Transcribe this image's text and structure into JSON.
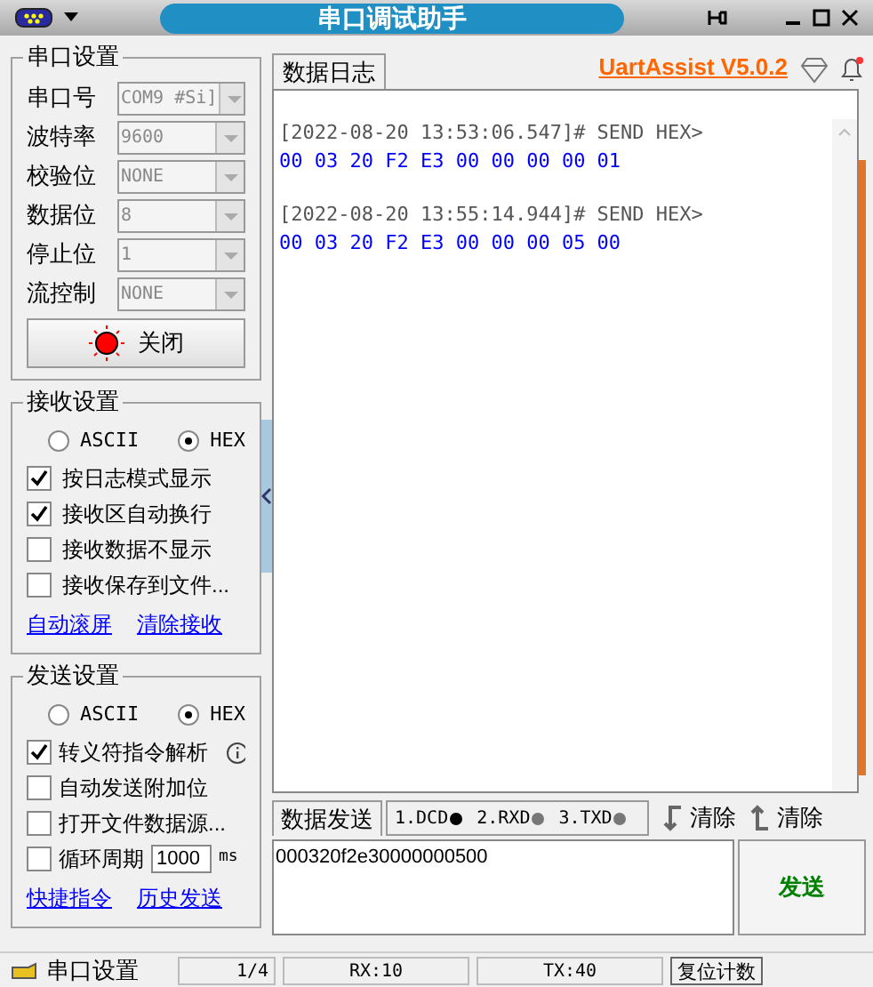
{
  "window": {
    "title": "串口调试助手"
  },
  "port_settings": {
    "title": "串口设置",
    "fields": [
      {
        "label": "串口号",
        "value": "COM9 #Si]"
      },
      {
        "label": "波特率",
        "value": "9600"
      },
      {
        "label": "校验位",
        "value": "NONE"
      },
      {
        "label": "数据位",
        "value": "8"
      },
      {
        "label": "停止位",
        "value": "1"
      },
      {
        "label": "流控制",
        "value": "NONE"
      }
    ],
    "toggle_button": {
      "label": "关闭",
      "on": true
    }
  },
  "receive_settings": {
    "title": "接收设置",
    "modes": [
      {
        "label": "ASCII",
        "selected": false
      },
      {
        "label": "HEX",
        "selected": true
      }
    ],
    "options": [
      {
        "label": "按日志模式显示",
        "checked": true
      },
      {
        "label": "接收区自动换行",
        "checked": true
      },
      {
        "label": "接收数据不显示",
        "checked": false
      },
      {
        "label": "接收保存到文件...",
        "checked": false
      }
    ],
    "links": [
      "自动滚屏",
      "清除接收"
    ]
  },
  "send_settings": {
    "title": "发送设置",
    "modes": [
      {
        "label": "ASCII",
        "selected": false
      },
      {
        "label": "HEX",
        "selected": true
      }
    ],
    "options": [
      {
        "label": "转义符指令解析",
        "checked": true,
        "kind": "info"
      },
      {
        "label": "自动发送附加位",
        "checked": false,
        "kind": "plain"
      },
      {
        "label": "打开文件数据源...",
        "checked": false,
        "kind": "plain"
      },
      {
        "label": "循环周期",
        "checked": false,
        "kind": "period",
        "value": "1000",
        "unit": "ms"
      }
    ],
    "links": [
      "快捷指令",
      "历史发送"
    ]
  },
  "log_tab": {
    "label": "数据日志",
    "selected": true
  },
  "app_link": "UartAssist V5.0.2",
  "log": [
    {
      "header": "[2022-08-20 13:53:06.547]# SEND HEX>",
      "data": "00 03 20 F2 E3 00 00 00 00 01"
    },
    {
      "header": "[2022-08-20 13:55:14.944]# SEND HEX>",
      "data": "00 03 20 F2 E3 00 00 00 05 00"
    }
  ],
  "send_tab": {
    "label": "数据发送",
    "selected": true
  },
  "signals": [
    {
      "label": "1.DCD",
      "on": true
    },
    {
      "label": "2.RXD",
      "on": false
    },
    {
      "label": "3.TXD",
      "on": false
    }
  ],
  "clear_buttons": [
    "清除",
    "清除"
  ],
  "send_input": {
    "value": "000320f2e30000000500"
  },
  "send_button": "发送",
  "status_bar": {
    "label": "串口设置",
    "page": "1/4",
    "rx": "RX:10",
    "tx": "TX:40",
    "reset_button": "复位计数"
  }
}
